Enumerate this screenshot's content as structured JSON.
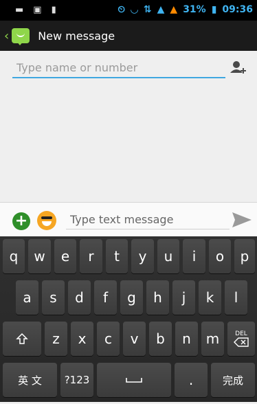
{
  "status_bar": {
    "battery_percent": "31%",
    "time": "09:36"
  },
  "action_bar": {
    "title": "New message"
  },
  "recipient": {
    "placeholder": "Type name or number"
  },
  "compose": {
    "placeholder": "Type text message"
  },
  "keyboard": {
    "row1": [
      "q",
      "w",
      "e",
      "r",
      "t",
      "y",
      "u",
      "i",
      "o",
      "p"
    ],
    "row2": [
      "a",
      "s",
      "d",
      "f",
      "g",
      "h",
      "j",
      "k",
      "l"
    ],
    "row3": [
      "z",
      "x",
      "c",
      "v",
      "b",
      "n",
      "m"
    ],
    "del_label": "DEL",
    "language_label": "英 文",
    "symbols_label": "?123",
    "period_label": ".",
    "done_label": "完成"
  }
}
